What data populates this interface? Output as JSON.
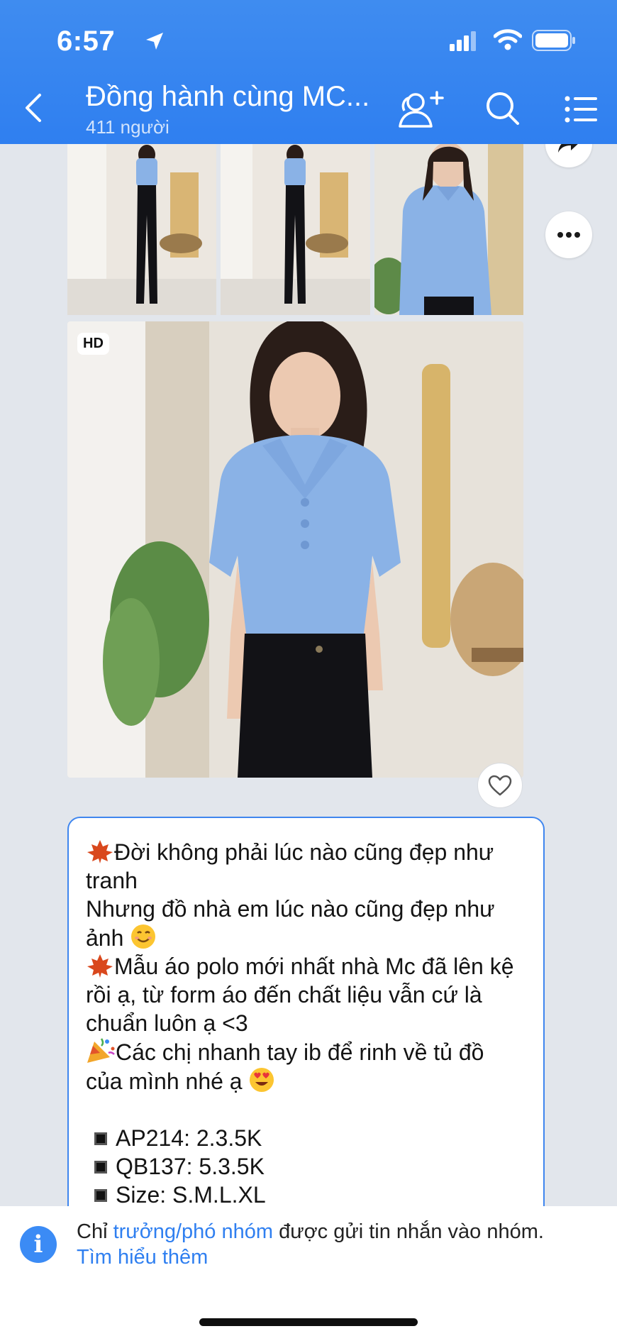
{
  "status": {
    "time": "6:57"
  },
  "header": {
    "title": "Đồng hành cùng MC...",
    "member_count": "411 người"
  },
  "icons": {
    "back": "chevron-left-icon",
    "add_member": "add-user-icon",
    "search": "search-icon",
    "menu": "list-menu-icon",
    "share": "share-forward-icon",
    "more": "more-dots-icon",
    "heart": "heart-icon"
  },
  "media": {
    "hd_badge": "HD"
  },
  "message": {
    "lines": [
      "Đời không phải lúc nào cũng đẹp như tranh",
      "Nhưng đồ nhà em lúc nào cũng đẹp như ảnh",
      "Mẫu áo polo mới nhất nhà Mc đã lên kệ rồi ạ, từ form áo đến chất liệu vẫn cứ là chuẩn luôn ạ <3",
      "Các chị nhanh tay ib để rinh về tủ đồ của mình nhé ạ"
    ],
    "items": [
      "AP214: 2.3.5K",
      "QB137: 5.3.5K",
      "Size: S.M.L.XL"
    ]
  },
  "footer": {
    "prefix": "Chỉ ",
    "role_link": "trưởng/phó nhóm",
    "suffix": " được gửi tin nhắn vào nhóm.",
    "learn_more": "Tìm hiểu thêm"
  },
  "colors": {
    "header_blue": "#3b88f0",
    "link_blue": "#2f7ff0",
    "shirt_blue": "#8ab2e6"
  }
}
